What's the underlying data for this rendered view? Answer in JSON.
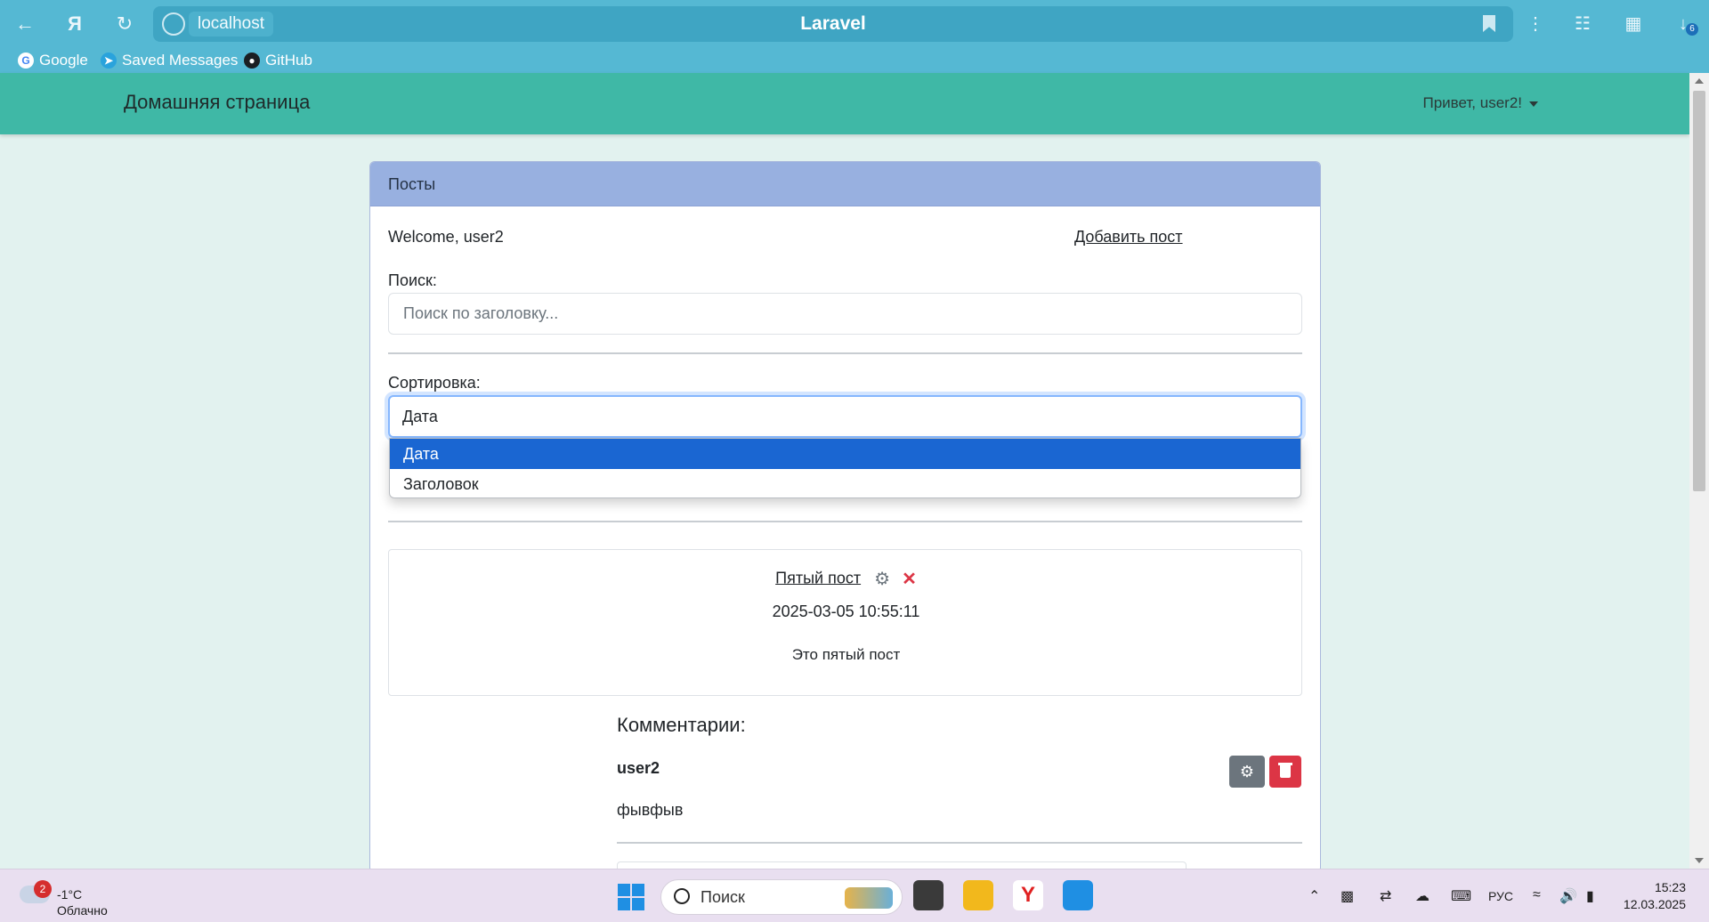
{
  "browser": {
    "address": "localhost",
    "page_title": "Laravel",
    "bookmarks": [
      "Google",
      "Saved Messages",
      "GitHub"
    ],
    "downloads_count": "6"
  },
  "navbar": {
    "brand": "Домашняя страница",
    "user_menu": "Привет, user2!"
  },
  "card": {
    "header": "Посты",
    "welcome": "Welcome, user2",
    "add_post": "Добавить пост",
    "search_label": "Поиск:",
    "search_placeholder": "Поиск по заголовку...",
    "sort_label": "Сортировка:",
    "sort_value": "Дата",
    "sort_options": [
      "Дата",
      "Заголовок"
    ]
  },
  "post": {
    "title": "Пятый пост",
    "date": "2025-03-05 10:55:11",
    "body": "Это пятый пост"
  },
  "comments": {
    "title": "Комментарии:",
    "items": [
      {
        "user": "user2",
        "text": "фывфыв"
      }
    ]
  },
  "taskbar": {
    "weather_badge": "2",
    "weather_temp": "-1°C",
    "weather_desc": "Облачно",
    "search_text": "Поиск",
    "language": "РУС",
    "time": "15:23",
    "date": "12.03.2025"
  }
}
